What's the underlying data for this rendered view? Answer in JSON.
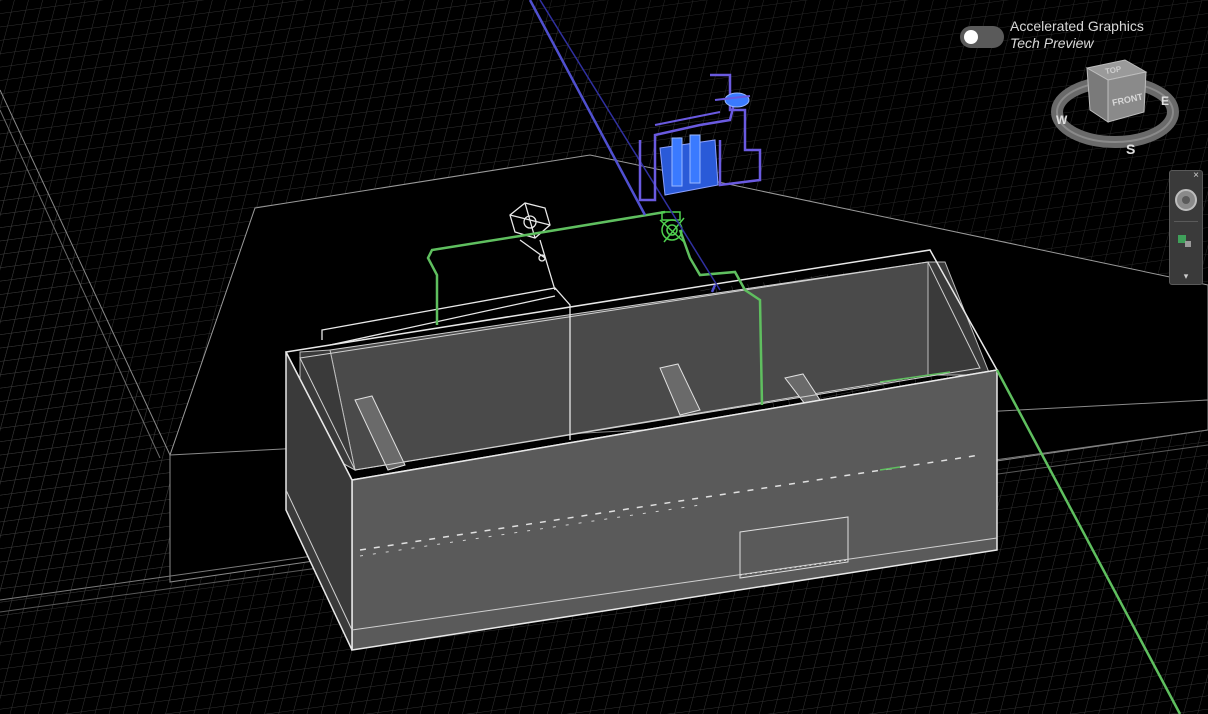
{
  "accelerated_graphics": {
    "title": "Accelerated Graphics",
    "subtitle": "Tech Preview",
    "enabled": false
  },
  "viewcube": {
    "top_label": "TOP",
    "front_label": "FRONT",
    "compass_w": "W",
    "compass_e": "E",
    "compass_s": "S"
  },
  "navbar": {
    "close_glyph": "×",
    "more_glyph": "▾"
  },
  "colors": {
    "background": "#000000",
    "grid": "#3a3a3a",
    "tank_front": "#5a5a5a",
    "tank_side": "#3a3a3a",
    "tank_interior": "#4a4a4a",
    "tank_rim": "#8a8a8a",
    "pipe_green": "#5fbf5f",
    "pipe_blue": "#5050d0",
    "equipment_blue": "#2a5ad8",
    "wireframe": "#e0e0e0"
  }
}
